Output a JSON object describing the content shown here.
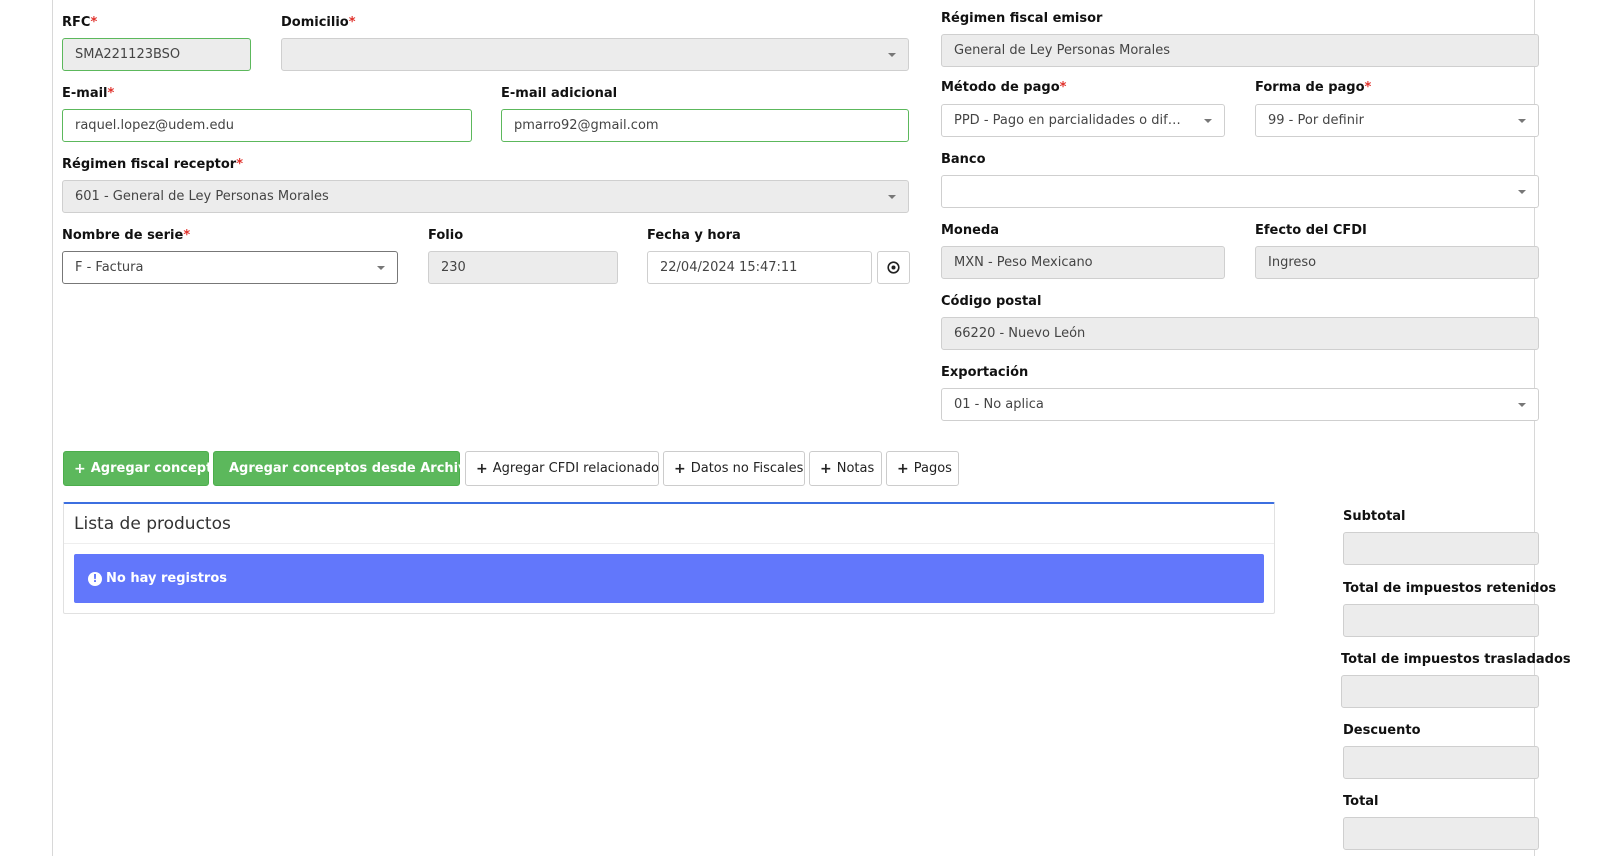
{
  "form": {
    "rfc": {
      "label": "RFC",
      "value": "SMA221123BSO"
    },
    "domicilio": {
      "label": "Domicilio",
      "value": ""
    },
    "email": {
      "label": "E-mail",
      "value": "raquel.lopez@udem.edu"
    },
    "email_adicional": {
      "label": "E-mail adicional",
      "value": "pmarro92@gmail.com"
    },
    "regimen_receptor": {
      "label": "Régimen fiscal receptor",
      "value": "601 - General de Ley Personas Morales"
    },
    "nombre_serie": {
      "label": "Nombre de serie",
      "value": "F - Factura"
    },
    "folio": {
      "label": "Folio",
      "value": "230"
    },
    "fecha_hora": {
      "label": "Fecha y hora",
      "value": "22/04/2024 15:47:11"
    },
    "required_marker": "*"
  },
  "emisor": {
    "regimen_emisor": {
      "label": "Régimen fiscal emisor",
      "value": "General de Ley Personas Morales"
    },
    "metodo_pago": {
      "label": "Método de pago",
      "value": "PPD - Pago en parcialidades o diferido"
    },
    "forma_pago": {
      "label": "Forma de pago",
      "value": "99 - Por definir"
    },
    "banco": {
      "label": "Banco",
      "value": ""
    },
    "moneda": {
      "label": "Moneda",
      "value": "MXN - Peso Mexicano"
    },
    "efecto": {
      "label": "Efecto del CFDI",
      "value": "Ingreso"
    },
    "codigo_postal": {
      "label": "Código postal",
      "value": "66220 - Nuevo León"
    },
    "exportacion": {
      "label": "Exportación",
      "value": "01 - No aplica"
    }
  },
  "toolbar": {
    "agregar_concepto": "Agregar concepto",
    "agregar_archivo": "Agregar conceptos desde Archivo",
    "agregar_cfdi": "Agregar CFDI relacionado",
    "datos_no_fiscales": "Datos no Fiscales",
    "notas": "Notas",
    "pagos": "Pagos"
  },
  "productos": {
    "title": "Lista de productos",
    "empty_message": "No hay registros"
  },
  "totales": {
    "subtotal": "Subtotal",
    "retenidos": "Total de impuestos retenidos",
    "trasladados": "Total de impuestos trasladados",
    "descuento": "Descuento",
    "total": "Total"
  },
  "colors": {
    "accent_green": "#5cb85c",
    "alert_blue": "#6277fb",
    "required_red": "#e0312b"
  }
}
